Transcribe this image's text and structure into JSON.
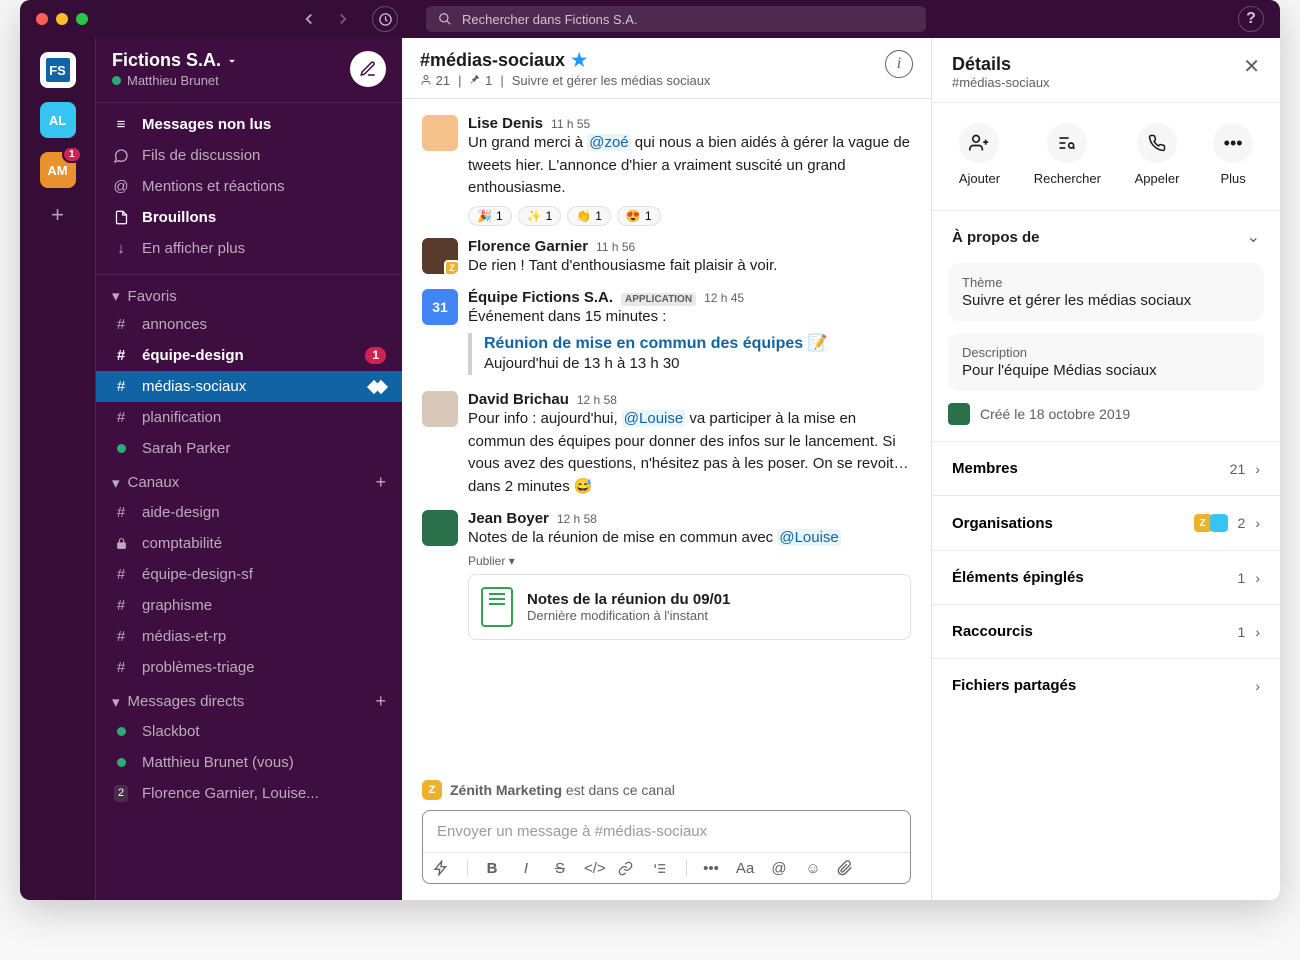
{
  "search": {
    "placeholder": "Rechercher dans Fictions S.A."
  },
  "rail": {
    "ws1": "FS",
    "ws2": "AL",
    "ws3": "AM",
    "ws3_badge": "1"
  },
  "workspace": {
    "name": "Fictions S.A.",
    "user": "Matthieu Brunet"
  },
  "nav": {
    "unread": "Messages non lus",
    "threads": "Fils de discussion",
    "mentions": "Mentions et réactions",
    "drafts": "Brouillons",
    "more": "En afficher plus"
  },
  "sections": {
    "favoris": "Favoris",
    "canaux": "Canaux",
    "dms": "Messages directs"
  },
  "favoris": {
    "annonces": "annonces",
    "equipe_design": "équipe-design",
    "equipe_design_badge": "1",
    "medias_sociaux": "médias-sociaux",
    "planification": "planification",
    "sarah": "Sarah Parker"
  },
  "canaux": {
    "aide_design": "aide-design",
    "comptabilite": "comptabilité",
    "equipe_design_sf": "équipe-design-sf",
    "graphisme": "graphisme",
    "medias_et_rp": "médias-et-rp",
    "problemes_triage": "problèmes-triage"
  },
  "dms": {
    "slackbot": "Slackbot",
    "matthieu": "Matthieu Brunet (vous)",
    "florence": "Florence Garnier, Louise...",
    "florence_count": "2"
  },
  "channel": {
    "title": "#médias-sociaux",
    "members": "21",
    "pins": "1",
    "topic": "Suivre et gérer les médias sociaux"
  },
  "composer": {
    "placeholder": "Envoyer un message à #médias-sociaux"
  },
  "notice": {
    "org": "Zénith Marketing",
    "text": " est dans ce canal"
  },
  "msg1": {
    "name": "Lise Denis",
    "time": "11 h 55",
    "text_a": "Un grand merci à ",
    "mention": "@zoé",
    "text_b": " qui nous a bien aidés à gérer la vague de tweets hier. L'annonce d'hier a vraiment suscité un grand enthousiasme.",
    "r1": "🎉",
    "r1c": "1",
    "r2": "✨",
    "r2c": "1",
    "r3": "👏",
    "r3c": "1",
    "r4": "😍",
    "r4c": "1"
  },
  "msg2": {
    "name": "Florence Garnier",
    "time": "11 h 56",
    "text": "De rien ! Tant d'enthousiasme fait plaisir à voir."
  },
  "msg3": {
    "name": "Équipe Fictions S.A.",
    "badge": "APPLICATION",
    "time": "12 h 45",
    "text": "Événement dans 15 minutes :",
    "event_title": "Réunion de mise en commun des équipes",
    "event_emoji": "📝",
    "event_time": "Aujourd'hui de 13 h à 13 h 30",
    "cal": "31"
  },
  "msg4": {
    "name": "David Brichau",
    "time": "12 h 58",
    "text_a": "Pour info : aujourd'hui, ",
    "mention": "@Louise",
    "text_b": " va participer à la mise en commun des équipes pour donner des infos sur le lancement. Si vous avez des questions, n'hésitez pas à les poser. On se revoit… dans 2 minutes 😅"
  },
  "msg5": {
    "name": "Jean Boyer",
    "time": "12 h 58",
    "text_a": "Notes de la réunion de mise en commun avec ",
    "mention": "@Louise",
    "publish": "Publier ▾",
    "file_title": "Notes de la réunion du 09/01",
    "file_sub": "Dernière modification à l'instant"
  },
  "details": {
    "title": "Détails",
    "sub": "#médias-sociaux",
    "actions": {
      "add": "Ajouter",
      "search": "Rechercher",
      "call": "Appeler",
      "more": "Plus"
    },
    "about": "À propos de",
    "theme_label": "Thème",
    "theme_val": "Suivre et gérer les médias sociaux",
    "desc_label": "Description",
    "desc_val": "Pour l'équipe Médias sociaux",
    "created": "Créé le 18 octobre 2019",
    "members": "Membres",
    "members_count": "21",
    "orgs": "Organisations",
    "orgs_count": "2",
    "pinned": "Éléments épinglés",
    "pinned_count": "1",
    "shortcuts": "Raccourcis",
    "shortcuts_count": "1",
    "files": "Fichiers partagés"
  }
}
